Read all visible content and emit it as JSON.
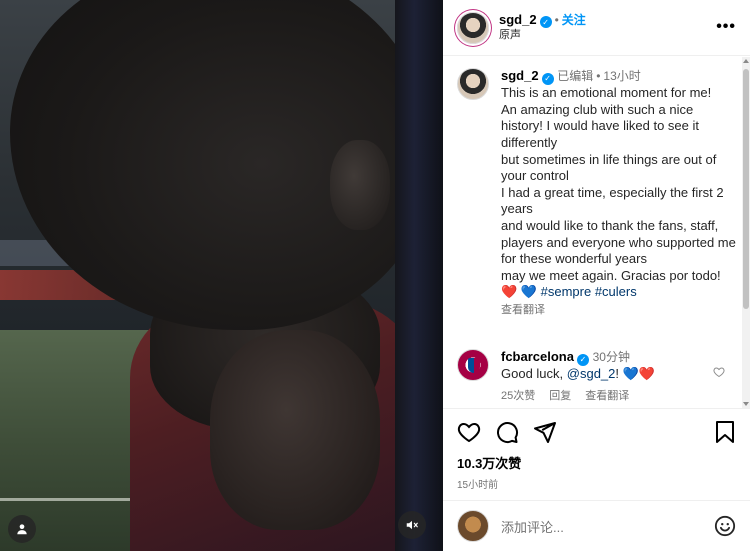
{
  "post": {
    "username": "sgd_2",
    "follow_label": "关注",
    "audio_label": "原声",
    "more_label": "•••"
  },
  "caption": {
    "username": "sgd_2",
    "edited_label": "已编辑",
    "time": "13小时",
    "lines": [
      "This is an emotional moment for me!",
      "An amazing club with such a nice history! I would have liked to see it differently",
      "but sometimes in life things are out of your control",
      "I had a great time, especially the first 2 years",
      "and would like to thank the fans, staff, players and everyone who supported me for these wonderful years",
      "may we meet again. Gracias por todo!"
    ],
    "emojis": "❤️ 💙",
    "hashtags": "#sempre #culers",
    "translate_label": "查看翻译"
  },
  "comment": {
    "username": "fcbarcelona",
    "time": "30分钟",
    "text_prefix": "Good luck, ",
    "mention": "@sgd_2",
    "text_suffix": "! 💙❤️",
    "likes": "25次赞",
    "reply_label": "回复",
    "translate_label": "查看翻译"
  },
  "actions": {
    "likes": "10.3万次赞",
    "posted_time": "15小时前"
  },
  "composer": {
    "placeholder": "添加评论..."
  },
  "colors": {
    "accent": "#0095f6",
    "heart_red": "#ed4956",
    "heart_blue": "#3b5bdb",
    "link": "#00376b"
  }
}
